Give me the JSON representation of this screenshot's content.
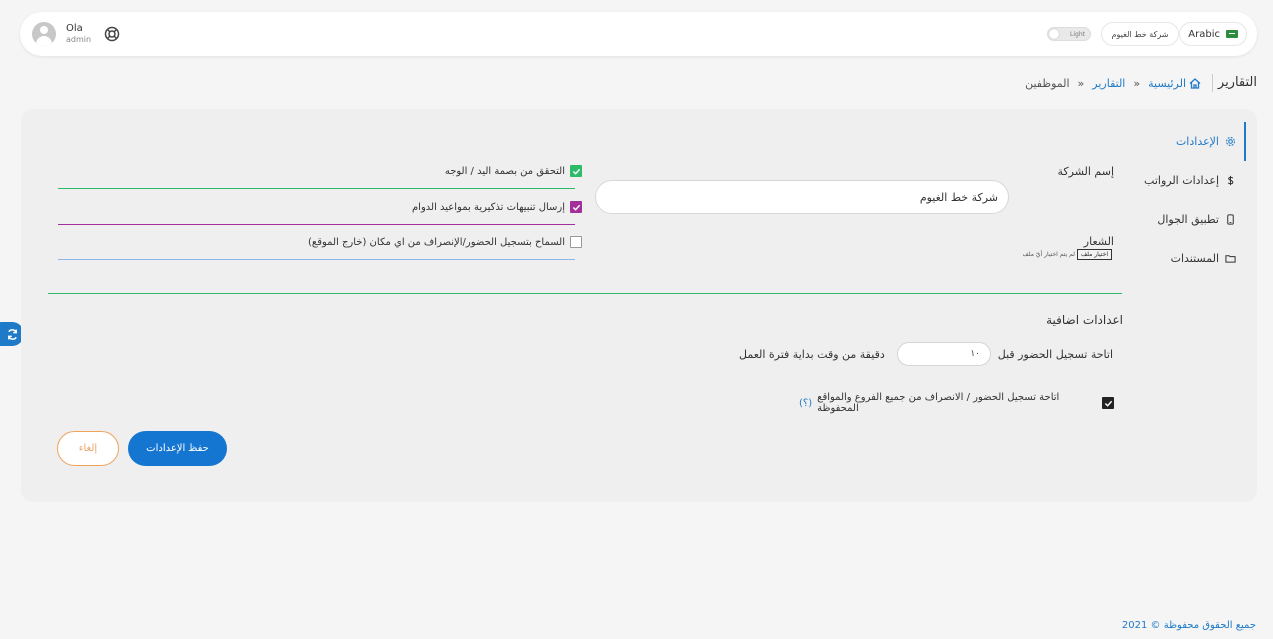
{
  "header": {
    "user_name": "Ola",
    "user_role": "admin",
    "language_label": "Arabic",
    "company_pill": "شركة خط الغيوم",
    "theme_label": "Light"
  },
  "breadcrumb": {
    "page_title": "التقارير",
    "home": "الرئيسية",
    "reports": "التقارير",
    "separator": "»",
    "current": "الموظفين"
  },
  "tabs": [
    {
      "label": "الإعدادات",
      "icon": "gear-icon",
      "active": true
    },
    {
      "label": "إعدادات الرواتب",
      "icon": "dollar-icon",
      "active": false
    },
    {
      "label": "تطبيق الجوال",
      "icon": "mobile-icon",
      "active": false
    },
    {
      "label": "المستندات",
      "icon": "folder-icon",
      "active": false
    }
  ],
  "form": {
    "company_name_label": "إسم الشركة",
    "company_name_value": "شركة خط الغيوم",
    "logo_label": "الشعار",
    "file_button": "اختيار ملف",
    "file_status": "لم يتم اختيار أيّ ملف",
    "checkboxes": [
      {
        "label": "التحقق من بصمة اليد / الوجه",
        "checked": true,
        "color": "#2dbb6a"
      },
      {
        "label": "إرسال تنبيهات تذكيرية بمواعيد الدوام",
        "checked": true,
        "color": "#a3309a"
      },
      {
        "label": "السماح بتسجيل الحضور/الإنصراف من اي مكان (خارج الموقع)",
        "checked": false,
        "color": "#8bb8e8"
      }
    ],
    "extra_section_title": "اعدادات اضافية",
    "allow_before_label": "اتاحة تسجيل الحضور قبل",
    "minutes_value": "١٠",
    "minutes_suffix": "دقيقة من وقت بداية فترة العمل",
    "all_branches_label": "اتاحة تسجيل الحضور / الانصراف من جميع الفروع والمواقع المحفوظة",
    "help_link": "(؟)",
    "save_button": "حفظ الإعدادات",
    "cancel_button": "إلغاء"
  },
  "footer": {
    "text": "جميع الحقوق محفوظة © 2021"
  },
  "colors": {
    "accent": "#1576d1",
    "cancel_border": "#f0a35c",
    "green_line": "#2dbb6a"
  }
}
